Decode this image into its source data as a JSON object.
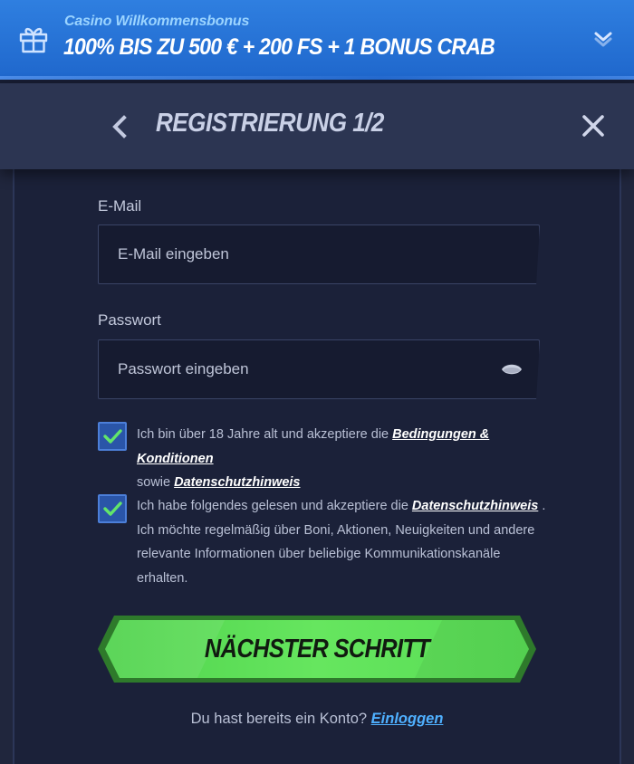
{
  "banner": {
    "subtitle": "Casino Willkommensbonus",
    "title": "100% BIS ZU 500 € + 200 FS + 1 BONUS CRAB",
    "icon": "gift-icon",
    "toggle_icon": "chevron-down-icon"
  },
  "header": {
    "title": "REGISTRIERUNG 1/2",
    "back_icon": "chevron-left-icon",
    "close_icon": "close-icon"
  },
  "form": {
    "email": {
      "label": "E-Mail",
      "value": "",
      "placeholder": "E-Mail eingeben"
    },
    "password": {
      "label": "Passwort",
      "value": "",
      "placeholder": "Passwort eingeben",
      "toggle_icon": "eye-icon"
    },
    "consent_terms": {
      "checked": true,
      "text_before": "Ich bin über 18 Jahre alt und akzeptiere die ",
      "link_terms": "Bedingungen & Konditionen",
      "text_middle": " sowie ",
      "link_privacy": "Datenschutzhinweis"
    },
    "consent_marketing": {
      "checked": true,
      "text_before": "Ich habe folgendes gelesen und akzeptiere die ",
      "link_privacy": "Datenschutzhinweis",
      "text_after": " . Ich möchte regelmäßig über Boni, Aktionen, Neuigkeiten und andere relevante Informationen über beliebige Kommunikationskanäle erhalten."
    },
    "submit_label": "NÄCHSTER SCHRITT",
    "login_prompt": "Du hast bereits ein Konto?",
    "login_link": "Einloggen"
  },
  "colors": {
    "banner_bg": "#2575d8",
    "header_bg": "#2c3552",
    "body_bg": "#1b2139",
    "accent_green": "#5de05a",
    "checkbox_blue": "#2a55a8",
    "link_blue": "#4fb0ff"
  }
}
